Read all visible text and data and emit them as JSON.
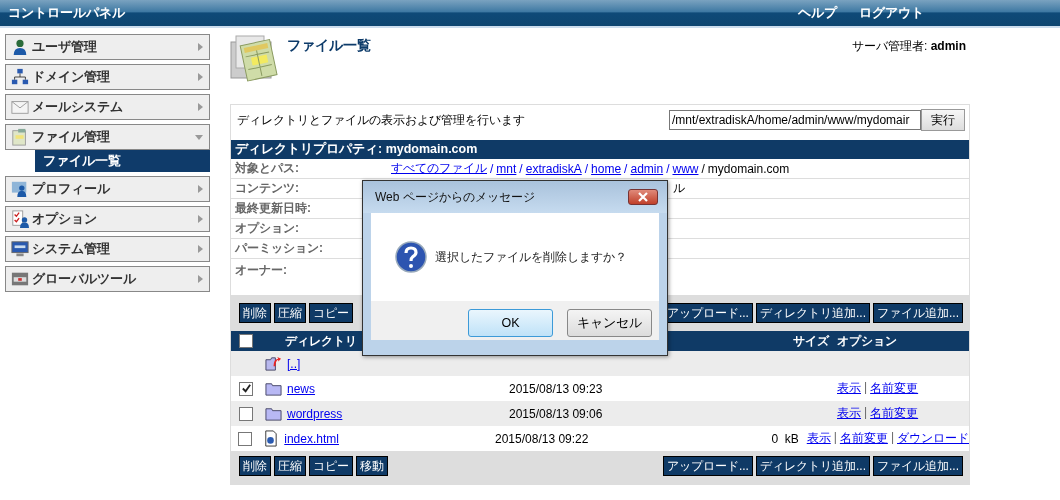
{
  "header": {
    "title": "コントロールパネル",
    "links": [
      "ヘルプ",
      "ログアウト"
    ]
  },
  "sidebar": {
    "items": [
      {
        "label": "ユーザ管理",
        "kind": "user",
        "expanded": false
      },
      {
        "label": "ドメイン管理",
        "kind": "network",
        "expanded": false
      },
      {
        "label": "メールシステム",
        "kind": "mail",
        "expanded": false
      },
      {
        "label": "ファイル管理",
        "kind": "file",
        "expanded": true,
        "children": [
          {
            "label": "ファイル一覧",
            "selected": true
          }
        ]
      },
      {
        "label": "プロフィール",
        "kind": "profile",
        "expanded": false
      },
      {
        "label": "オプション",
        "kind": "options",
        "expanded": false
      },
      {
        "label": "システム管理",
        "kind": "system",
        "expanded": false
      },
      {
        "label": "グローバルツール",
        "kind": "tools",
        "expanded": false
      }
    ]
  },
  "page": {
    "title": "ファイル一覧",
    "user_label": "サーバ管理者:",
    "user": "admin"
  },
  "description": "ディレクトリとファイルの表示および管理を行います",
  "path_field": {
    "value": "/mnt/extradiskA/home/admin/www/mydomair",
    "button": "実行"
  },
  "properties": {
    "title": "ディレクトリプロパティ: mydomain.com",
    "rows": [
      {
        "label": "対象とパス:",
        "links": [
          "すべてのファイル",
          "mnt",
          "extradiskA",
          "home",
          "admin",
          "www"
        ],
        "separator": "/",
        "value": "mydomain.com"
      },
      {
        "label": "コンテンツ:",
        "value": "ル"
      },
      {
        "label": "最終更新日時:"
      },
      {
        "label": "オプション:"
      },
      {
        "label": "パーミッション:"
      },
      {
        "label": "オーナー:"
      }
    ]
  },
  "top_toolbar": {
    "left": [
      "削除",
      "圧縮",
      "コピー"
    ],
    "right": [
      "アップロード...",
      "ディレクトリ追加...",
      "ファイル追加..."
    ]
  },
  "file_table": {
    "columns": [
      "ディレクトリ",
      "サイズ",
      "オプション"
    ],
    "header_checked": false,
    "option_separator": "|",
    "rows": [
      {
        "kind": "parent",
        "name": "[..]"
      },
      {
        "kind": "folder",
        "name": "news",
        "checked": true,
        "date": "2015/08/13 09:23",
        "options": [
          "表示",
          "名前変更"
        ]
      },
      {
        "kind": "folder",
        "name": "wordpress",
        "checked": false,
        "date": "2015/08/13 09:06",
        "options": [
          "表示",
          "名前変更"
        ]
      },
      {
        "kind": "file",
        "name": "index.html",
        "checked": false,
        "date": "2015/08/13 09:22",
        "size": "0  kB",
        "options": [
          "表示",
          "名前変更",
          "ダウンロード"
        ]
      }
    ]
  },
  "bottom_toolbar": {
    "left": [
      "削除",
      "圧縮",
      "コピー",
      "移動"
    ],
    "right": [
      "アップロード...",
      "ディレクトリ追加...",
      "ファイル追加..."
    ]
  },
  "dialog": {
    "title": "Web ページからのメッセージ",
    "message": "選択したファイルを削除しますか？",
    "buttons": [
      "OK",
      "キャンセル"
    ]
  }
}
